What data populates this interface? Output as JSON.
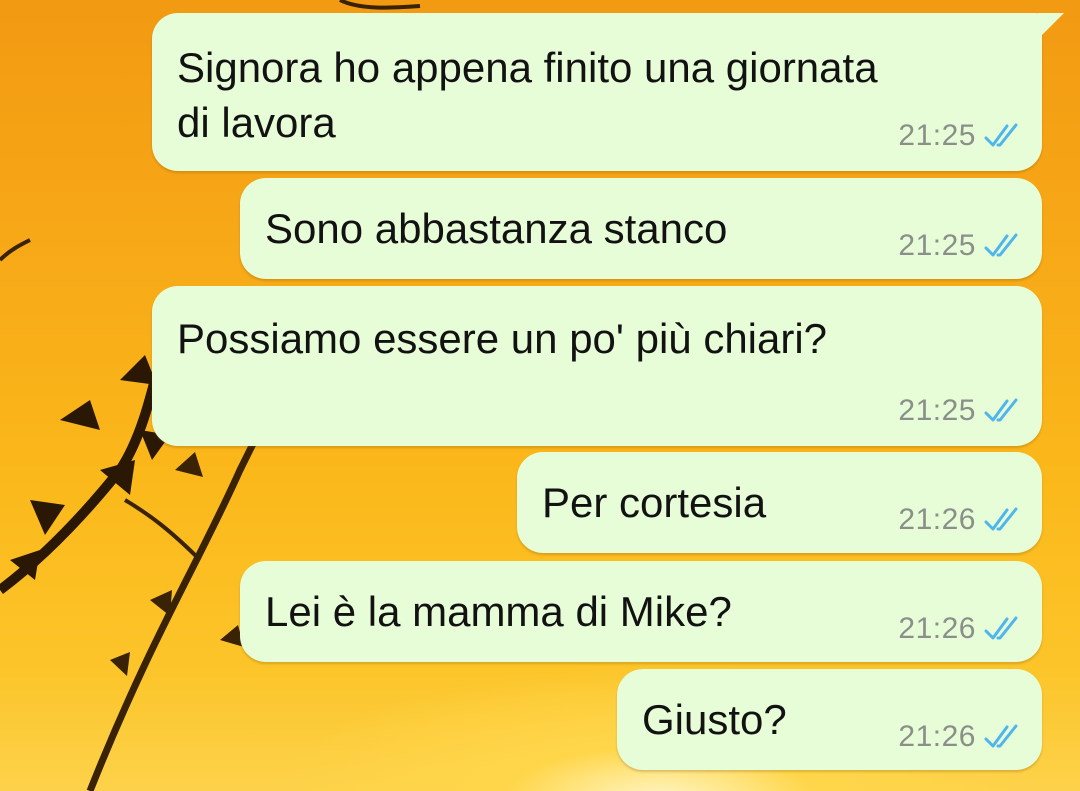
{
  "colors": {
    "bubble_bg": "#e7fdd8",
    "tick_read": "#4fb6ec",
    "time_text": "#8a8f89"
  },
  "messages": [
    {
      "text": "Signora ho appena finito una giornata\ndi lavora",
      "time": "21:25",
      "status": "read-double-check-icon"
    },
    {
      "text": "Sono abbastanza stanco",
      "time": "21:25",
      "status": "read-double-check-icon"
    },
    {
      "text": "Possiamo essere un po' più chiari?",
      "time": "21:25",
      "status": "read-double-check-icon"
    },
    {
      "text": "Per cortesia",
      "time": "21:26",
      "status": "read-double-check-icon"
    },
    {
      "text": "Lei è la mamma di Mike?",
      "time": "21:26",
      "status": "read-double-check-icon"
    },
    {
      "text": "Giusto?",
      "time": "21:26",
      "status": "read-double-check-icon"
    }
  ]
}
